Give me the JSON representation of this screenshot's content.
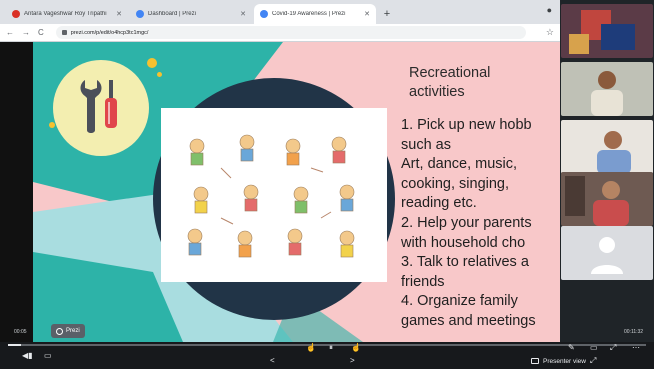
{
  "browser": {
    "tabs": [
      {
        "title": "Antara Vageshwar Roy Tripathi",
        "active": false,
        "favicon_color": "#d93025"
      },
      {
        "title": "Dashboard | Prezi",
        "active": false,
        "favicon_color": "#4285f4"
      },
      {
        "title": "Covid-19 Awareness | Prezi",
        "active": true,
        "favicon_color": "#4285f4"
      }
    ],
    "new_tab": "+",
    "url": "prezi.com/p/edit/o4hcp3tc1mgc/"
  },
  "slide": {
    "heading": "Recreational activities",
    "body": "1. Pick up new hobb\nsuch as\nArt, dance, music,\ncooking, singing,\nreading etc.\n2. Help your parents\nwith household cho\n3. Talk to relatives a\nfriends\n4. Organize family\ngames and meetings",
    "colors": {
      "pink": "#f8c8c9",
      "teal": "#2db3a8",
      "navy": "#213447",
      "light_teal": "#a9dde0",
      "yellow": "#f3eeb0"
    }
  },
  "prezi_badge": "Prezi",
  "player": {
    "time_elapsed": "00:05",
    "time_remaining": "00:11:32",
    "progress": 0.02,
    "presenter_view": "Presenter view",
    "prev": "<",
    "next": ">"
  },
  "icons": {
    "tools": "wrench-screwdriver-icon",
    "back": "arrow-left-icon",
    "forward": "arrow-right-icon",
    "reload": "reload-icon"
  }
}
